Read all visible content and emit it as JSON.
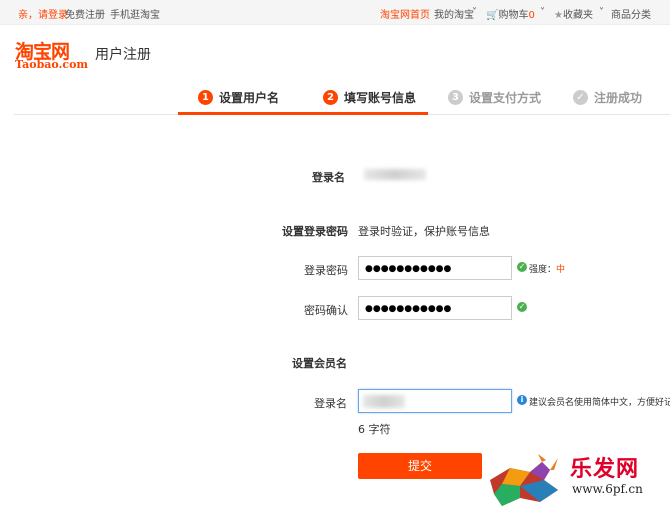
{
  "topbar": {
    "greeting": "亲，请登录",
    "register": "免费注册",
    "mobile": "手机逛淘宝",
    "home": "淘宝网首页",
    "my_taobao": "我的淘宝",
    "cart": "购物车",
    "cart_count": "0",
    "favorites": "收藏夹",
    "categories": "商品分类"
  },
  "header": {
    "logo_cn": "淘宝网",
    "logo_en": "Taobao.com",
    "title": "用户注册"
  },
  "steps": [
    {
      "num": "1",
      "label": "设置用户名"
    },
    {
      "num": "2",
      "label": "填写账号信息"
    },
    {
      "num": "3",
      "label": "设置支付方式"
    },
    {
      "num": "✓",
      "label": "注册成功"
    }
  ],
  "form": {
    "login_name_label": "登录名",
    "password_section": "设置登录密码",
    "password_section_hint": "登录时验证，保护账号信息",
    "password_label": "登录密码",
    "password_value": "●●●●●●●●●●●",
    "strength_label": "强度：",
    "strength_value": "中",
    "confirm_label": "密码确认",
    "confirm_value": "●●●●●●●●●●●",
    "member_section": "设置会员名",
    "member_label": "登录名",
    "member_hint": "建议会员名使用简体中文，方便好记",
    "char_count": "6 字符",
    "submit": "提交"
  },
  "watermark": {
    "text": "乐发网",
    "url": "www.6pf.cn"
  },
  "colors": {
    "accent": "#ff4400",
    "ok": "#4caf50",
    "info": "#2a87d8",
    "inactive": "#cccccc"
  }
}
